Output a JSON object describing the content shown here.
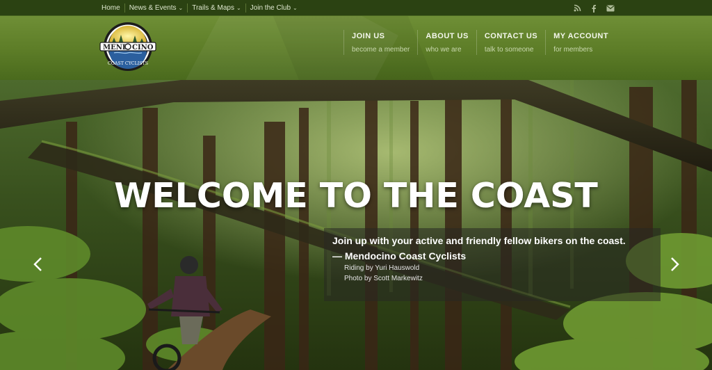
{
  "topbar": {
    "items": [
      {
        "label": "Home",
        "has_caret": false
      },
      {
        "label": "News & Events",
        "has_caret": true
      },
      {
        "label": "Trails & Maps",
        "has_caret": true
      },
      {
        "label": "Join the Club",
        "has_caret": true
      }
    ],
    "caret": "⌄",
    "social_icons": [
      "rss-icon",
      "facebook-icon",
      "envelope-icon"
    ]
  },
  "logo": {
    "word_top_left": "MEND",
    "word_top_right": "CINO",
    "word_bottom": "COAST CYCLISTS"
  },
  "nav": [
    {
      "title": "JOIN US",
      "subtitle": "become a member"
    },
    {
      "title": "ABOUT US",
      "subtitle": "who we are"
    },
    {
      "title": "CONTACT US",
      "subtitle": "talk to someone"
    },
    {
      "title": "MY ACCOUNT",
      "subtitle": "for members"
    }
  ],
  "hero": {
    "title": "WELCOME TO THE COAST",
    "caption_line1": "Join up with your active and friendly fellow bikers on the coast.",
    "caption_line2": "— Mendocino Coast Cyclists",
    "caption_line3": "Riding by Yuri Hauswold",
    "caption_line4": "Photo by Scott Markewitz"
  },
  "colors": {
    "topbar_bg": "#2b4212",
    "header_green": "#5c7c27",
    "accent_white": "#ffffff"
  }
}
